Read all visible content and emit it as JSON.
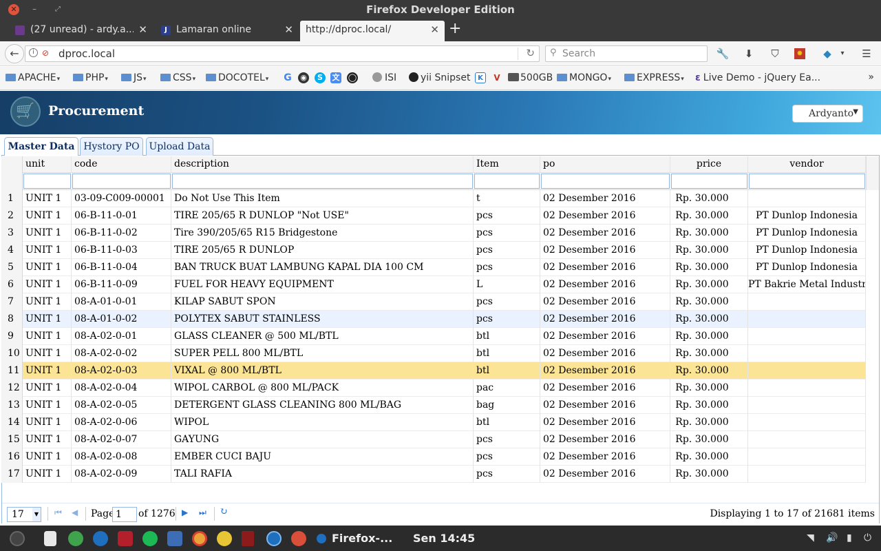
{
  "window": {
    "title": "Firefox Developer Edition"
  },
  "browser": {
    "tabs": [
      {
        "label": "(27 unread) - ardy.a...",
        "active": false,
        "favicon_color": "#6b3a8c"
      },
      {
        "label": "Lamaran online",
        "active": false,
        "favicon_color": "#2d3e8a"
      },
      {
        "label": "http://dproc.local/",
        "active": true,
        "favicon_color": ""
      }
    ],
    "url": "dproc.local",
    "search_placeholder": "Search",
    "bookmarks": [
      {
        "label": "APACHE",
        "type": "folder"
      },
      {
        "label": "PHP",
        "type": "folder"
      },
      {
        "label": "JS",
        "type": "folder"
      },
      {
        "label": "CSS",
        "type": "folder"
      },
      {
        "label": "DOCOTEL",
        "type": "folder"
      },
      {
        "label": "ISI",
        "type": "link"
      },
      {
        "label": "yii Snipset",
        "type": "link"
      },
      {
        "label": "500GB",
        "type": "link"
      },
      {
        "label": "MONGO",
        "type": "folder"
      },
      {
        "label": "EXPRESS",
        "type": "folder"
      },
      {
        "label": "Live Demo - jQuery Ea...",
        "type": "link"
      }
    ]
  },
  "app": {
    "title": "Procurement",
    "user": "Ardyanto",
    "tabs": [
      "Master Data",
      "Hystory PO",
      "Upload Data"
    ],
    "active_tab": 0
  },
  "grid": {
    "columns": [
      "unit",
      "code",
      "description",
      "Item",
      "po",
      "price",
      "vendor"
    ],
    "rows": [
      [
        "UNIT 1",
        "03-09-C009-00001",
        "Do Not Use This Item",
        "t",
        "02 Desember 2016",
        "Rp. 30.000",
        ""
      ],
      [
        "UNIT 1",
        "06-B-11-0-01",
        "TIRE 205/65 R DUNLOP \"Not USE\"",
        "pcs",
        "02 Desember 2016",
        "Rp. 30.000",
        "PT Dunlop Indonesia"
      ],
      [
        "UNIT 1",
        "06-B-11-0-02",
        "Tire 390/205/65 R15 Bridgestone",
        "pcs",
        "02 Desember 2016",
        "Rp. 30.000",
        "PT Dunlop Indonesia"
      ],
      [
        "UNIT 1",
        "06-B-11-0-03",
        "TIRE 205/65 R DUNLOP",
        "pcs",
        "02 Desember 2016",
        "Rp. 30.000",
        "PT Dunlop Indonesia"
      ],
      [
        "UNIT 1",
        "06-B-11-0-04",
        "BAN TRUCK BUAT LAMBUNG KAPAL DIA 100 CM",
        "pcs",
        "02 Desember 2016",
        "Rp. 30.000",
        "PT Dunlop Indonesia"
      ],
      [
        "UNIT 1",
        "06-B-11-0-09",
        "FUEL FOR HEAVY EQUIPMENT",
        "L",
        "02 Desember 2016",
        "Rp. 30.000",
        "PT Bakrie Metal Industri"
      ],
      [
        "UNIT 1",
        "08-A-01-0-01",
        "KILAP SABUT SPON",
        "pcs",
        "02 Desember 2016",
        "Rp. 30.000",
        ""
      ],
      [
        "UNIT 1",
        "08-A-01-0-02",
        "POLYTEX SABUT STAINLESS",
        "pcs",
        "02 Desember 2016",
        "Rp. 30.000",
        ""
      ],
      [
        "UNIT 1",
        "08-A-02-0-01",
        "GLASS CLEANER @ 500 ML/BTL",
        "btl",
        "02 Desember 2016",
        "Rp. 30.000",
        ""
      ],
      [
        "UNIT 1",
        "08-A-02-0-02",
        "SUPER PELL 800 ML/BTL",
        "btl",
        "02 Desember 2016",
        "Rp. 30.000",
        ""
      ],
      [
        "UNIT 1",
        "08-A-02-0-03",
        "VIXAL @ 800 ML/BTL",
        "btl",
        "02 Desember 2016",
        "Rp. 30.000",
        ""
      ],
      [
        "UNIT 1",
        "08-A-02-0-04",
        "WIPOL CARBOL @ 800 ML/PACK",
        "pac",
        "02 Desember 2016",
        "Rp. 30.000",
        ""
      ],
      [
        "UNIT 1",
        "08-A-02-0-05",
        "DETERGENT GLASS CLEANING 800 ML/BAG",
        "bag",
        "02 Desember 2016",
        "Rp. 30.000",
        ""
      ],
      [
        "UNIT 1",
        "08-A-02-0-06",
        "WIPOL",
        "btl",
        "02 Desember 2016",
        "Rp. 30.000",
        ""
      ],
      [
        "UNIT 1",
        "08-A-02-0-07",
        "GAYUNG",
        "pcs",
        "02 Desember 2016",
        "Rp. 30.000",
        ""
      ],
      [
        "UNIT 1",
        "08-A-02-0-08",
        "EMBER CUCI BAJU",
        "pcs",
        "02 Desember 2016",
        "Rp. 30.000",
        ""
      ],
      [
        "UNIT 1",
        "08-A-02-0-09",
        "TALI RAFIA",
        "pcs",
        "02 Desember 2016",
        "Rp. 30.000",
        ""
      ]
    ],
    "hover_row": 8,
    "selected_row": 11
  },
  "pager": {
    "page_size": "17",
    "page_label": "Page",
    "page": "1",
    "of_label": "of 1276",
    "info": "Displaying 1 to 17 of 21681 items"
  },
  "taskbar": {
    "app_label": "Firefox-...",
    "clock": "Sen 14:45"
  }
}
